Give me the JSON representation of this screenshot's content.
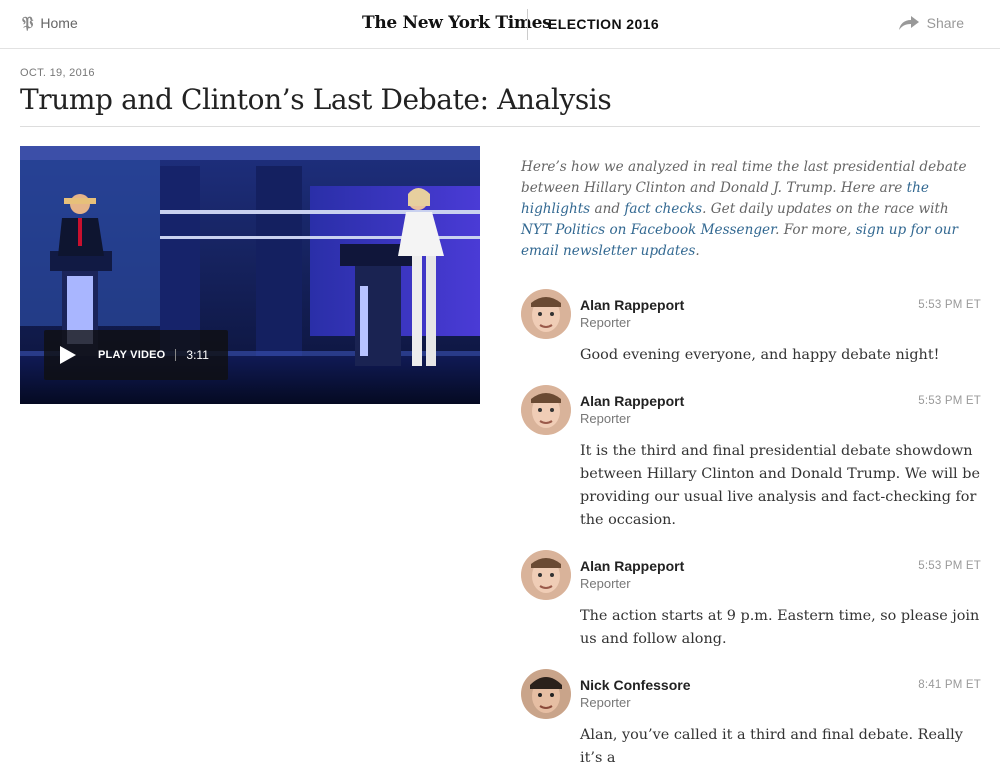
{
  "topbar": {
    "home_label": "Home",
    "masthead": "The New York Times",
    "section": "ELECTION 2016",
    "share_label": "Share"
  },
  "article": {
    "date": "OCT. 19, 2016",
    "headline": "Trump and Clinton’s Last Debate: Analysis"
  },
  "video": {
    "play_label": "PLAY VIDEO",
    "duration": "3:11"
  },
  "intro": {
    "t1": "Here’s how we analyzed in real time the last presidential debate between Hillary Clinton and Donald J. Trump. Here are ",
    "link1": "the highlights",
    "t2": " and ",
    "link2": "fact checks",
    "t3": ". Get daily updates on the race with ",
    "link3": "NYT Politics on Facebook Messenger",
    "t4": ". For more, ",
    "link4": "sign up for our email newsletter updates",
    "t5": "."
  },
  "posts": [
    {
      "author": "Alan Rappeport",
      "role": "Reporter",
      "time": "5:53 PM ET",
      "body": "Good evening everyone, and happy debate night!"
    },
    {
      "author": "Alan Rappeport",
      "role": "Reporter",
      "time": "5:53 PM ET",
      "body": "It is the third and final presidential debate showdown between Hillary Clinton and Donald Trump. We will be providing our usual live analysis and fact-checking for the occasion."
    },
    {
      "author": "Alan Rappeport",
      "role": "Reporter",
      "time": "5:53 PM ET",
      "body": "The action starts at 9 p.m. Eastern time, so please join us and follow along."
    },
    {
      "author": "Nick Confessore",
      "role": "Reporter",
      "time": "8:41 PM ET",
      "body": "Alan, you’ve called it a third and final debate. Really it’s a"
    }
  ],
  "colors": {
    "link": "#326891",
    "stage_blue": "#1b2d7a"
  },
  "icons": {
    "home": "nyt-t-icon",
    "share": "share-arrow-icon",
    "play": "play-icon"
  }
}
